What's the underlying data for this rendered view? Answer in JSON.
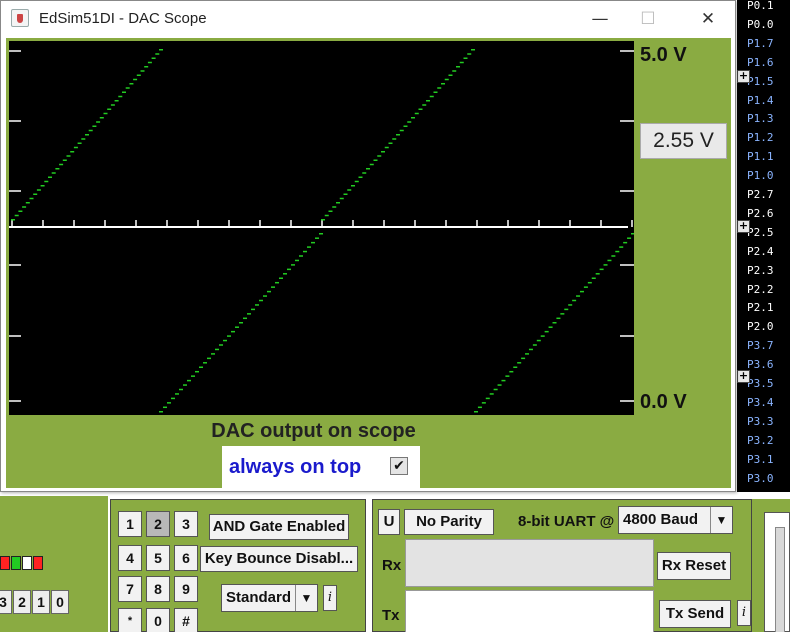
{
  "window": {
    "title": "EdSim51DI - DAC Scope",
    "minimize": "—",
    "maximize": "☐",
    "close": "✕"
  },
  "scope": {
    "max_label": "5.0 V",
    "min_label": "0.0 V",
    "readout": "2.55 V",
    "caption": "DAC output on scope",
    "always_on_top_label": "always on top",
    "always_on_top_checked": true,
    "trace_color": "#22cc22"
  },
  "pins": [
    {
      "label": "P0.1",
      "color": "#ffffff"
    },
    {
      "label": "P0.0",
      "color": "#ffffff"
    },
    {
      "label": "P1.7",
      "color": "#8ab4ff"
    },
    {
      "label": "P1.6",
      "color": "#8ab4ff"
    },
    {
      "label": "P1.5",
      "color": "#8ab4ff"
    },
    {
      "label": "P1.4",
      "color": "#8ab4ff"
    },
    {
      "label": "P1.3",
      "color": "#8ab4ff"
    },
    {
      "label": "P1.2",
      "color": "#8ab4ff"
    },
    {
      "label": "P1.1",
      "color": "#8ab4ff"
    },
    {
      "label": "P1.0",
      "color": "#8ab4ff"
    },
    {
      "label": "P2.7",
      "color": "#ffffff"
    },
    {
      "label": "P2.6",
      "color": "#ffffff"
    },
    {
      "label": "P2.5",
      "color": "#ffffff"
    },
    {
      "label": "P2.4",
      "color": "#ffffff"
    },
    {
      "label": "P2.3",
      "color": "#ffffff"
    },
    {
      "label": "P2.2",
      "color": "#ffffff"
    },
    {
      "label": "P2.1",
      "color": "#ffffff"
    },
    {
      "label": "P2.0",
      "color": "#ffffff"
    },
    {
      "label": "P3.7",
      "color": "#8ab4ff"
    },
    {
      "label": "P3.6",
      "color": "#8ab4ff"
    },
    {
      "label": "P3.5",
      "color": "#8ab4ff"
    },
    {
      "label": "P3.4",
      "color": "#8ab4ff"
    },
    {
      "label": "P3.3",
      "color": "#8ab4ff"
    },
    {
      "label": "P3.2",
      "color": "#8ab4ff"
    },
    {
      "label": "P3.1",
      "color": "#8ab4ff"
    },
    {
      "label": "P3.0",
      "color": "#8ab4ff"
    }
  ],
  "plus_buttons": [
    "+",
    "+",
    "+"
  ],
  "leds": [
    "#ff2222",
    "#22cc22",
    "#ffffff",
    "#ff2222"
  ],
  "bit_buttons": [
    "3",
    "2",
    "1",
    "0"
  ],
  "keypad": {
    "keys": [
      "1",
      "2",
      "3",
      "4",
      "5",
      "6",
      "7",
      "8",
      "9",
      "*",
      "0",
      "#"
    ],
    "selected": "2",
    "and_gate": "AND Gate Enabled",
    "key_bounce": "Key Bounce Disabl...",
    "mode": "Standard",
    "mode_arrow": "▼",
    "info": "i"
  },
  "uart": {
    "u_button": "U",
    "parity": "No Parity",
    "mode_label": "8-bit UART @",
    "baud": "4800 Baud",
    "baud_arrow": "▼",
    "rx_label": "Rx",
    "tx_label": "Tx",
    "rx_reset": "Rx Reset",
    "tx_send": "Tx Send",
    "info": "i"
  }
}
